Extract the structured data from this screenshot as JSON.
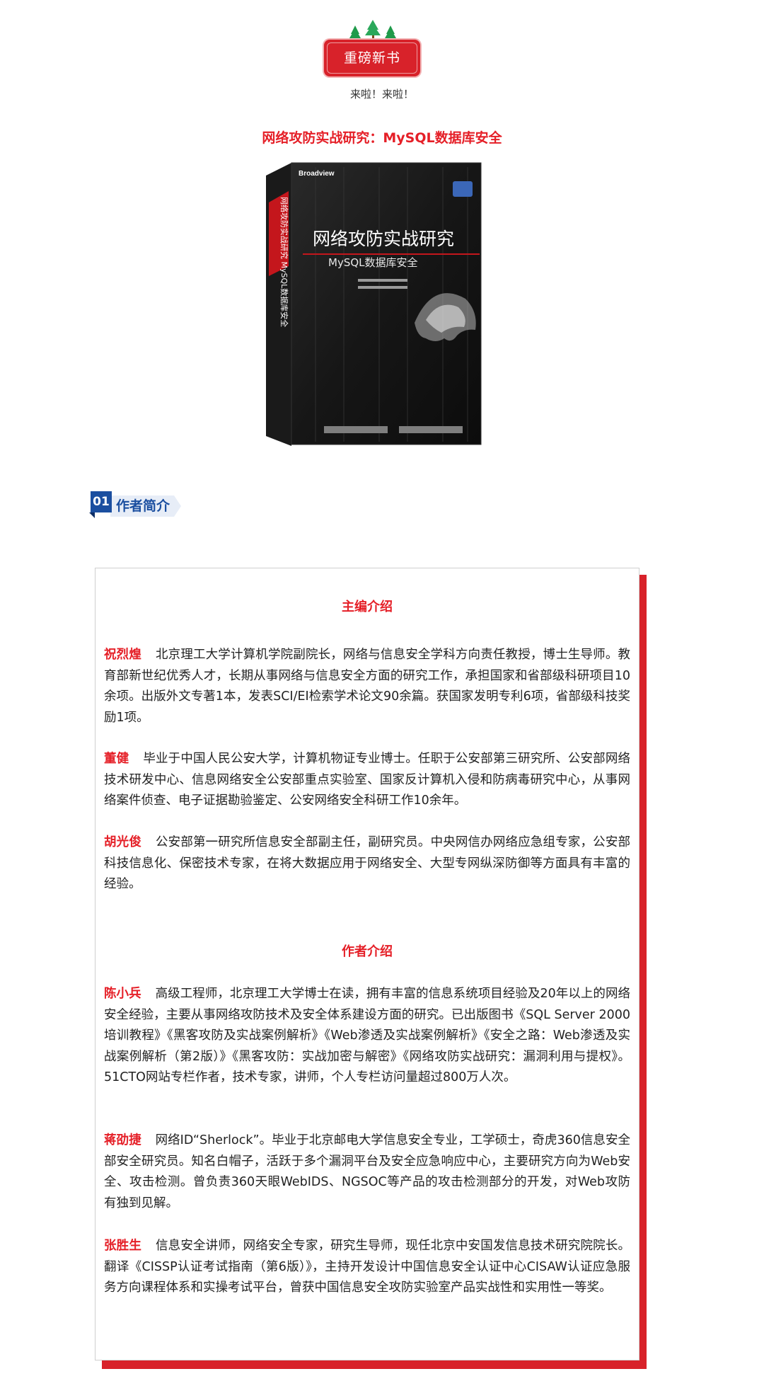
{
  "header": {
    "badge_text": "重磅新书",
    "subtitle": "来啦！来啦！",
    "book_title": "网络攻防实战研究：MySQL数据库安全"
  },
  "book_cover": {
    "publisher_logo": "Broadview",
    "title_line1": "网络攻防实战研究",
    "title_line2": "MySQL数据库安全",
    "spine_text": "网络攻防实战研究 MySQL数据库安全",
    "colors": {
      "red": "#d8222a",
      "black": "#111111"
    }
  },
  "section": {
    "number": "01",
    "label": "作者简介"
  },
  "editors_heading": "主编介绍",
  "editors": [
    {
      "name": "祝烈煌",
      "bio": "北京理工大学计算机学院副院长，网络与信息安全学科方向责任教授，博士生导师。教育部新世纪优秀人才，长期从事网络与信息安全方面的研究工作，承担国家和省部级科研项目10余项。出版外文专著1本，发表SCI/EI检索学术论文90余篇。获国家发明专利6项，省部级科技奖励1项。"
    },
    {
      "name": "董健",
      "bio": "毕业于中国人民公安大学，计算机物证专业博士。任职于公安部第三研究所、公安部网络技术研发中心、信息网络安全公安部重点实验室、国家反计算机入侵和防病毒研究中心，从事网络案件侦查、电子证据勘验鉴定、公安网络安全科研工作10余年。"
    },
    {
      "name": "胡光俊",
      "bio": "公安部第一研究所信息安全部副主任，副研究员。中央网信办网络应急组专家，公安部科技信息化、保密技术专家，在将大数据应用于网络安全、大型专网纵深防御等方面具有丰富的经验。"
    }
  ],
  "authors_heading": "作者介绍",
  "authors": [
    {
      "name": "陈小兵",
      "bio": "高级工程师，北京理工大学博士在读，拥有丰富的信息系统项目经验及20年以上的网络安全经验，主要从事网络攻防技术及安全体系建设方面的研究。已出版图书《SQL Server 2000培训教程》《黑客攻防及实战案例解析》《Web渗透及实战案例解析》《安全之路：Web渗透及实战案例解析（第2版）》《黑客攻防：实战加密与解密》《网络攻防实战研究：漏洞利用与提权》。51CTO网站专栏作者，技术专家，讲师，个人专栏访问量超过800万人次。"
    },
    {
      "name": "蒋劭捷",
      "bio": "网络ID“Sherlock”。毕业于北京邮电大学信息安全专业，工学硕士，奇虎360信息安全部安全研究员。知名白帽子，活跃于多个漏洞平台及安全应急响应中心，主要研究方向为Web安全、攻击检测。曾负责360天眼WebIDS、NGSOC等产品的攻击检测部分的开发，对Web攻防有独到见解。"
    },
    {
      "name": "张胜生",
      "bio": "信息安全讲师，网络安全专家，研究生导师，现任北京中安国发信息技术研究院院长。翻译《CISSP认证考试指南（第6版）》，主持开发设计中国信息安全认证中心CISAW认证应急服务方向课程体系和实操考试平台，曾获中国信息安全攻防实验室产品实战性和实用性一等奖。"
    }
  ]
}
